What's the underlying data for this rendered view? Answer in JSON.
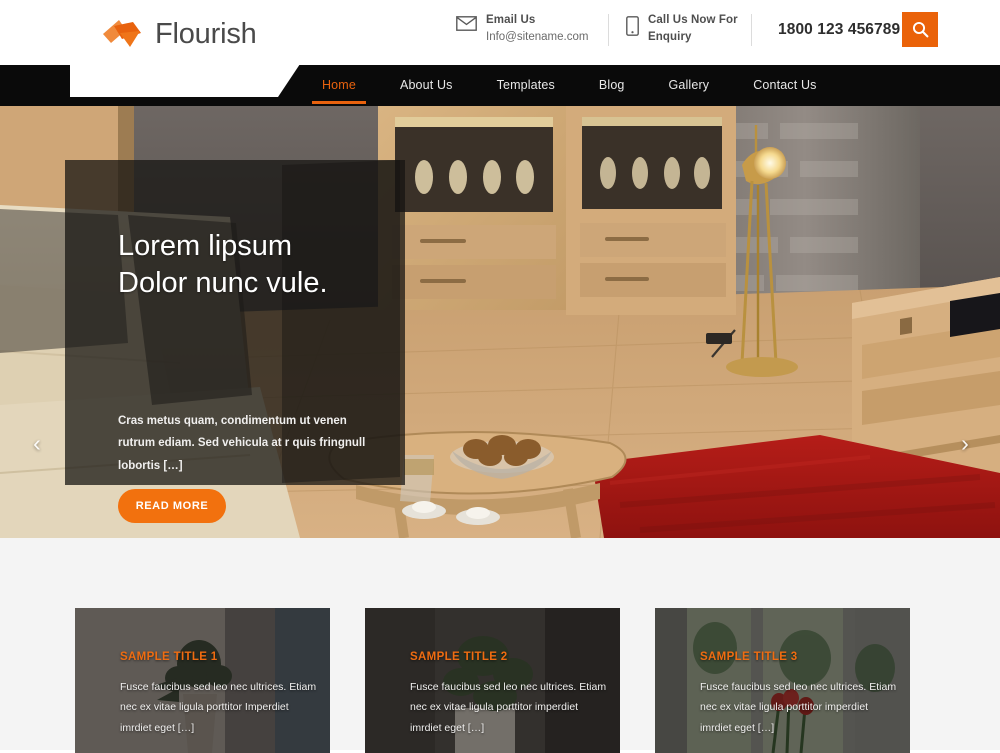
{
  "brand": {
    "name": "Flourish",
    "logo_icon": "leaf-arrow-logo-icon",
    "accent_color": "#e8620e"
  },
  "topbar": {
    "email": {
      "icon": "envelope-icon",
      "title": "Email Us",
      "value": "Info@sitename.com"
    },
    "phone": {
      "icon": "mobile-phone-icon",
      "title": "Call Us Now For",
      "title2": "Enquiry"
    },
    "phone_number": "1800 123 456789",
    "search": {
      "icon": "search-icon",
      "label": "Search"
    }
  },
  "nav": {
    "items": [
      {
        "label": "Home",
        "active": true
      },
      {
        "label": "About Us",
        "active": false
      },
      {
        "label": "Templates",
        "active": false
      },
      {
        "label": "Blog",
        "active": false
      },
      {
        "label": "Gallery",
        "active": false
      },
      {
        "label": "Contact Us",
        "active": false
      }
    ]
  },
  "hero": {
    "heading_line1": "Lorem lipsum",
    "heading_line2": "Dolor nunc vule.",
    "paragraph": "Cras metus quam, condimentum ut venen rutrum ediam. Sed vehicula at r quis fringnull lobortis […]",
    "cta_label": "READ MORE",
    "prev_icon": "chevron-left-icon",
    "next_icon": "chevron-right-icon",
    "prev_glyph": "‹",
    "next_glyph": "›"
  },
  "cards": [
    {
      "title": "SAMPLE TITLE 1",
      "text": "Fusce faucibus sed leo nec ultrices. Etiam nec ex vitae ligula porttitor Imperdiet imrdiet eget […]"
    },
    {
      "title": "SAMPLE TITLE 2",
      "text": "Fusce faucibus sed leo nec ultrices. Etiam nec ex vitae ligula porttitor imperdiet imrdiet eget […]"
    },
    {
      "title": "SAMPLE TITLE 3",
      "text": "Fusce faucibus sed leo nec ultrices. Etiam nec ex vitae ligula porttitor imperdiet imrdiet eget […]"
    }
  ]
}
